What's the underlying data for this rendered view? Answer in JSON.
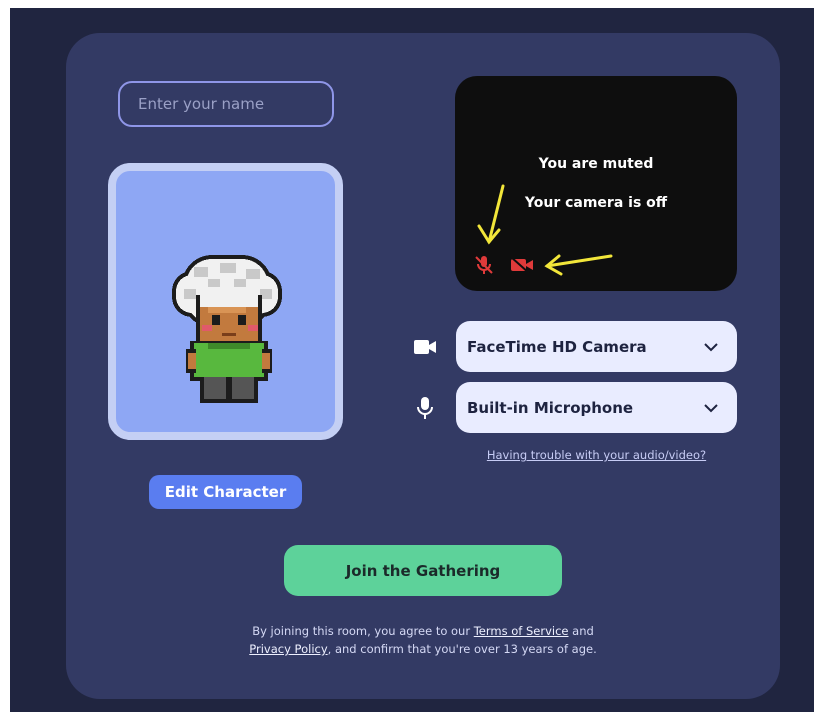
{
  "name_input": {
    "placeholder": "Enter your name",
    "value": ""
  },
  "avatar": {
    "edit_label": "Edit Character"
  },
  "video_preview": {
    "muted_text": "You are muted",
    "camera_text": "Your camera is off",
    "mic_icon": "mic-off-icon",
    "camera_icon": "camera-off-icon",
    "status_color": "#e03a3a",
    "annotation_color": "#f2e63a"
  },
  "devices": {
    "camera": {
      "icon": "video-camera-icon",
      "selected": "FaceTime HD Camera"
    },
    "microphone": {
      "icon": "microphone-icon",
      "selected": "Built-in Microphone"
    },
    "trouble_link": "Having trouble with your audio/video?"
  },
  "join_button": {
    "label": "Join the Gathering",
    "color": "#5dd29a"
  },
  "legal": {
    "prefix": "By joining this room, you agree to our",
    "terms_link": "Terms of Service",
    "and": "and",
    "privacy_link": "Privacy Policy",
    "suffix": ", and confirm that you're over 13 years of age."
  },
  "colors": {
    "background": "#202540",
    "card": "#333a64",
    "accent": "#5a7df0"
  }
}
